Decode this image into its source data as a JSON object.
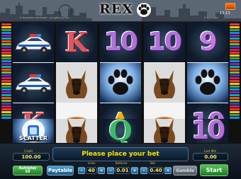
{
  "header": {
    "logo_text": "REX",
    "copyright": "© Greentube / Novomatic – all rights reserved",
    "version": "© Novomatic",
    "clock": "13:13"
  },
  "reels": [
    [
      {
        "symbol": "police-car",
        "bg": "dark"
      },
      {
        "symbol": "police-car",
        "bg": "dark"
      },
      {
        "symbol": "K",
        "bg": "dark"
      }
    ],
    [
      {
        "symbol": "K",
        "bg": "dark"
      },
      {
        "symbol": "dog",
        "bg": "white"
      },
      {
        "symbol": "sausage-roll",
        "bg": "white"
      }
    ],
    [
      {
        "symbol": "10",
        "bg": "dark"
      },
      {
        "symbol": "paw",
        "bg": "blue"
      },
      {
        "symbol": "A",
        "bg": "dark"
      }
    ],
    [
      {
        "symbol": "10",
        "bg": "dark"
      },
      {
        "symbol": "dog",
        "bg": "white"
      },
      {
        "symbol": "sausage-roll",
        "bg": "white"
      }
    ],
    [
      {
        "symbol": "9",
        "bg": "dark"
      },
      {
        "symbol": "paw",
        "bg": "blue"
      },
      {
        "symbol": "10",
        "bg": "dark"
      }
    ]
  ],
  "reel_extra_row": [
    {
      "symbol": "scatter",
      "bg": "blue"
    },
    {
      "symbol": "dog",
      "bg": "white"
    },
    {
      "symbol": "Q",
      "bg": "dark"
    },
    {
      "symbol": "dog",
      "bg": "white"
    },
    {
      "symbol": "10",
      "bg": "dark"
    }
  ],
  "scatter_label": "SCATTER",
  "panel": {
    "credit_label": "Credit",
    "credit_value": "100.00",
    "message": "Please place your bet",
    "last_win_label": "Last Win",
    "last_win_value": "0.00",
    "autoplay_label": "Autoplay",
    "autoplay_sub": "50",
    "paytable_label": "Paytable",
    "lines_label": "Lines",
    "lines_value": "40",
    "betline_label": "Bet/Line",
    "betline_value": "0.01",
    "bet_label": "Bet",
    "bet_value": "0.40",
    "gamble_label": "Gamble",
    "start_label": "Start",
    "minus": "–",
    "plus": "+"
  },
  "colors": {
    "message": "#ffe200",
    "start_button": "#2e9a33",
    "paytable_button": "#2a7fb5"
  }
}
